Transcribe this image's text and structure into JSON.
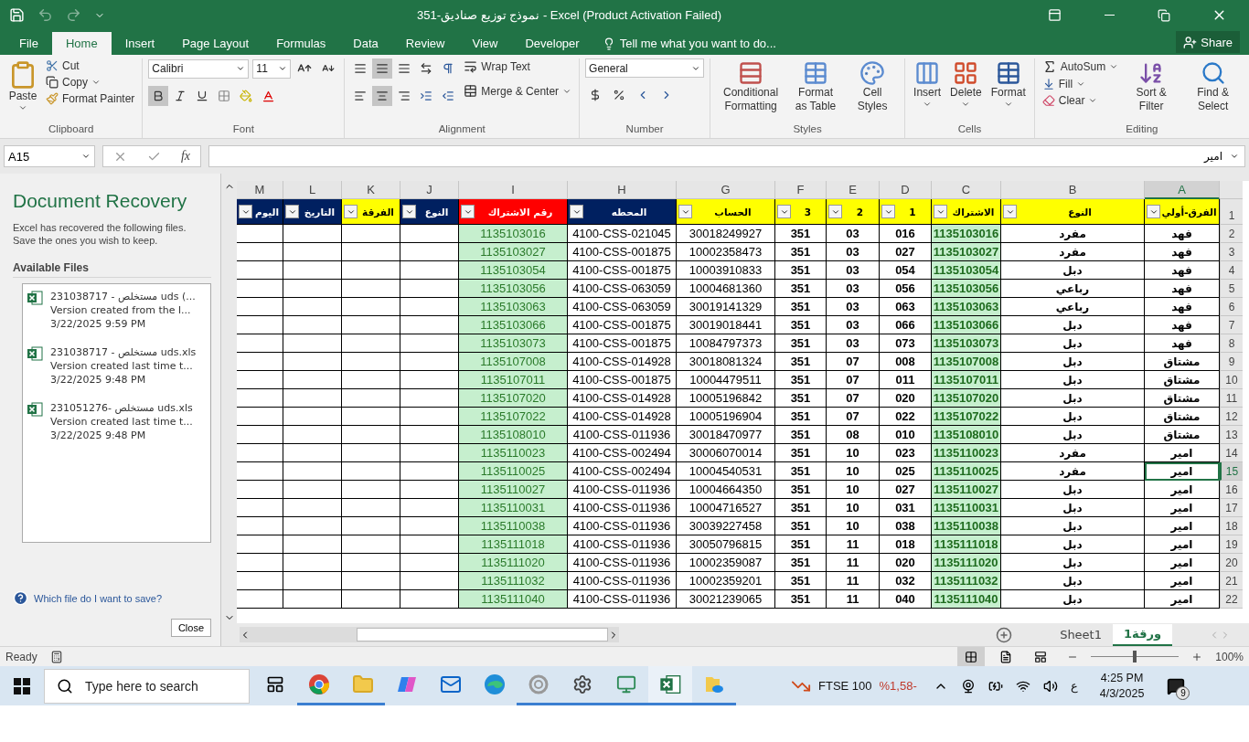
{
  "title_bar": {
    "title": "351-نموذج توزيع صناديق - Excel (Product Activation Failed)"
  },
  "tabs": [
    {
      "label": "File",
      "selected": false
    },
    {
      "label": "Home",
      "selected": true
    },
    {
      "label": "Insert",
      "selected": false
    },
    {
      "label": "Page Layout",
      "selected": false
    },
    {
      "label": "Formulas",
      "selected": false
    },
    {
      "label": "Data",
      "selected": false
    },
    {
      "label": "Review",
      "selected": false
    },
    {
      "label": "View",
      "selected": false
    },
    {
      "label": "Developer",
      "selected": false
    }
  ],
  "tell_me": "Tell me what you want to do...",
  "share": "Share",
  "ribbon": {
    "clipboard": {
      "label": "Clipboard",
      "paste": "Paste",
      "cut": "Cut",
      "copy": "Copy",
      "format_painter": "Format Painter"
    },
    "font": {
      "label": "Font",
      "font_name": "Calibri",
      "font_size": "11"
    },
    "alignment": {
      "label": "Alignment",
      "wrap": "Wrap Text",
      "merge": "Merge & Center"
    },
    "number": {
      "label": "Number",
      "format": "General"
    },
    "styles": {
      "label": "Styles",
      "items": [
        "Conditional Formatting",
        "Format as Table",
        "Cell Styles"
      ]
    },
    "cells": {
      "label": "Cells",
      "items": [
        "Insert",
        "Delete",
        "Format"
      ]
    },
    "editing": {
      "label": "Editing",
      "autosum": "AutoSum",
      "fill": "Fill",
      "clear": "Clear",
      "sort": "Sort & Filter",
      "find": "Find & Select"
    }
  },
  "formula_bar": {
    "name_box": "A15",
    "fx": "fx",
    "value": "امير"
  },
  "recovery": {
    "title": "Document Recovery",
    "message": "Excel has recovered the following files. Save the ones you wish to keep.",
    "section": "Available Files",
    "files": [
      {
        "name": "231038717 - مستخلص uds (...",
        "note": "Version created from the l...",
        "date": "3/22/2025 9:59 PM"
      },
      {
        "name": "231038717 - مستخلص uds.xls",
        "note": "Version created last time t...",
        "date": "3/22/2025 9:48 PM"
      },
      {
        "name": "231051276- مستخلص uds.xls",
        "note": "Version created last time t...",
        "date": "3/22/2025 9:48 PM"
      }
    ],
    "help": "Which file do I want to save?",
    "close": "Close"
  },
  "grid": {
    "columns": [
      {
        "letter": "M",
        "header": "اليوم",
        "color": "#002060",
        "selected": false
      },
      {
        "letter": "L",
        "header": "التاريخ",
        "color": "#002060",
        "selected": false
      },
      {
        "letter": "K",
        "header": "الفرقة",
        "color": "#ffff00",
        "selected": false
      },
      {
        "letter": "J",
        "header": "النوع",
        "color": "#002060",
        "selected": false
      },
      {
        "letter": "I",
        "header": "رقم الاشتراك",
        "color": "#ff0000",
        "selected": false
      },
      {
        "letter": "H",
        "header": "المحطه",
        "color": "#002060",
        "selected": false
      },
      {
        "letter": "G",
        "header": "الحساب",
        "color": "#ffff00",
        "selected": false
      },
      {
        "letter": "F",
        "header": "3",
        "color": "#ffff00",
        "selected": false
      },
      {
        "letter": "E",
        "header": "2",
        "color": "#ffff00",
        "selected": false
      },
      {
        "letter": "D",
        "header": "1",
        "color": "#ffff00",
        "selected": false
      },
      {
        "letter": "C",
        "header": "الاشتراك",
        "color": "#ffff00",
        "selected": false
      },
      {
        "letter": "B",
        "header": "النوع",
        "color": "#ffff00",
        "selected": false
      },
      {
        "letter": "A",
        "header": "الفرق-أولي",
        "color": "#ffff00",
        "selected": true
      }
    ],
    "header_row": "1",
    "rows": [
      {
        "number": "2",
        "selected": false,
        "cells": [
          "",
          "",
          "",
          "",
          "1135103016",
          "4100-CSS-021045",
          "30018249927",
          "351",
          "03",
          "016",
          "1135103016",
          "مفرد",
          "فهد"
        ]
      },
      {
        "number": "3",
        "selected": false,
        "cells": [
          "",
          "",
          "",
          "",
          "1135103027",
          "4100-CSS-001875",
          "10002358473",
          "351",
          "03",
          "027",
          "1135103027",
          "مفرد",
          "فهد"
        ]
      },
      {
        "number": "4",
        "selected": false,
        "cells": [
          "",
          "",
          "",
          "",
          "1135103054",
          "4100-CSS-001875",
          "10003910833",
          "351",
          "03",
          "054",
          "1135103054",
          "دبل",
          "فهد"
        ]
      },
      {
        "number": "5",
        "selected": false,
        "cells": [
          "",
          "",
          "",
          "",
          "1135103056",
          "4100-CSS-063059",
          "10004681360",
          "351",
          "03",
          "056",
          "1135103056",
          "رباعي",
          "فهد"
        ]
      },
      {
        "number": "6",
        "selected": false,
        "cells": [
          "",
          "",
          "",
          "",
          "1135103063",
          "4100-CSS-063059",
          "30019141329",
          "351",
          "03",
          "063",
          "1135103063",
          "رباعي",
          "فهد"
        ]
      },
      {
        "number": "7",
        "selected": false,
        "cells": [
          "",
          "",
          "",
          "",
          "1135103066",
          "4100-CSS-001875",
          "30019018441",
          "351",
          "03",
          "066",
          "1135103066",
          "دبل",
          "فهد"
        ]
      },
      {
        "number": "8",
        "selected": false,
        "cells": [
          "",
          "",
          "",
          "",
          "1135103073",
          "4100-CSS-001875",
          "10084797373",
          "351",
          "03",
          "073",
          "1135103073",
          "دبل",
          "فهد"
        ]
      },
      {
        "number": "9",
        "selected": false,
        "cells": [
          "",
          "",
          "",
          "",
          "1135107008",
          "4100-CSS-014928",
          "30018081324",
          "351",
          "07",
          "008",
          "1135107008",
          "دبل",
          "مشتاق"
        ]
      },
      {
        "number": "10",
        "selected": false,
        "cells": [
          "",
          "",
          "",
          "",
          "1135107011",
          "4100-CSS-001875",
          "10004479511",
          "351",
          "07",
          "011",
          "1135107011",
          "دبل",
          "مشتاق"
        ]
      },
      {
        "number": "11",
        "selected": false,
        "cells": [
          "",
          "",
          "",
          "",
          "1135107020",
          "4100-CSS-014928",
          "10005196842",
          "351",
          "07",
          "020",
          "1135107020",
          "دبل",
          "مشتاق"
        ]
      },
      {
        "number": "12",
        "selected": false,
        "cells": [
          "",
          "",
          "",
          "",
          "1135107022",
          "4100-CSS-014928",
          "10005196904",
          "351",
          "07",
          "022",
          "1135107022",
          "دبل",
          "مشتاق"
        ]
      },
      {
        "number": "13",
        "selected": false,
        "cells": [
          "",
          "",
          "",
          "",
          "1135108010",
          "4100-CSS-011936",
          "30018470977",
          "351",
          "08",
          "010",
          "1135108010",
          "دبل",
          "مشتاق"
        ]
      },
      {
        "number": "14",
        "selected": false,
        "cells": [
          "",
          "",
          "",
          "",
          "1135110023",
          "4100-CSS-002494",
          "30006070014",
          "351",
          "10",
          "023",
          "1135110023",
          "مفرد",
          "امير"
        ]
      },
      {
        "number": "15",
        "selected": true,
        "cells": [
          "",
          "",
          "",
          "",
          "1135110025",
          "4100-CSS-002494",
          "10004540531",
          "351",
          "10",
          "025",
          "1135110025",
          "مفرد",
          "امير"
        ]
      },
      {
        "number": "16",
        "selected": false,
        "cells": [
          "",
          "",
          "",
          "",
          "1135110027",
          "4100-CSS-011936",
          "10004664350",
          "351",
          "10",
          "027",
          "1135110027",
          "دبل",
          "امير"
        ]
      },
      {
        "number": "17",
        "selected": false,
        "cells": [
          "",
          "",
          "",
          "",
          "1135110031",
          "4100-CSS-011936",
          "10004716527",
          "351",
          "10",
          "031",
          "1135110031",
          "دبل",
          "امير"
        ]
      },
      {
        "number": "18",
        "selected": false,
        "cells": [
          "",
          "",
          "",
          "",
          "1135110038",
          "4100-CSS-011936",
          "30039227458",
          "351",
          "10",
          "038",
          "1135110038",
          "دبل",
          "امير"
        ]
      },
      {
        "number": "19",
        "selected": false,
        "cells": [
          "",
          "",
          "",
          "",
          "1135111018",
          "4100-CSS-011936",
          "30050796815",
          "351",
          "11",
          "018",
          "1135111018",
          "دبل",
          "امير"
        ]
      },
      {
        "number": "20",
        "selected": false,
        "cells": [
          "",
          "",
          "",
          "",
          "1135111020",
          "4100-CSS-011936",
          "10002359087",
          "351",
          "11",
          "020",
          "1135111020",
          "دبل",
          "امير"
        ]
      },
      {
        "number": "21",
        "selected": false,
        "cells": [
          "",
          "",
          "",
          "",
          "1135111032",
          "4100-CSS-011936",
          "10002359201",
          "351",
          "11",
          "032",
          "1135111032",
          "دبل",
          "امير"
        ]
      },
      {
        "number": "22",
        "selected": false,
        "cells": [
          "",
          "",
          "",
          "",
          "1135111040",
          "4100-CSS-011936",
          "30021239065",
          "351",
          "11",
          "040",
          "1135111040",
          "دبل",
          "امير"
        ]
      }
    ]
  },
  "sheet_tabs": [
    {
      "label": "Sheet1",
      "selected": false
    },
    {
      "label": "ورقة1",
      "selected": true
    }
  ],
  "status_bar": {
    "text": "Ready",
    "views": [
      {
        "selected": true
      },
      {
        "selected": false
      },
      {
        "selected": false
      }
    ],
    "zoom_slider": {
      "level": 0.5
    },
    "zoom": "100%"
  },
  "taskbar": {
    "search_placeholder": "Type here to search",
    "apps": [
      {
        "running": false,
        "active": false
      },
      {
        "running": true,
        "active": false
      },
      {
        "running": true,
        "active": false
      },
      {
        "running": false,
        "active": false
      },
      {
        "running": false,
        "active": false
      },
      {
        "running": false,
        "active": false
      },
      {
        "running": true,
        "active": false
      },
      {
        "running": true,
        "active": false
      },
      {
        "running": true,
        "active": false
      },
      {
        "running": true,
        "active": true
      },
      {
        "running": true,
        "active": false
      }
    ],
    "ticker": "FTSE 100",
    "change": "%1,58-",
    "language": "ع",
    "time": "4:25 PM",
    "date": "4/3/2025",
    "notifications": "9"
  }
}
